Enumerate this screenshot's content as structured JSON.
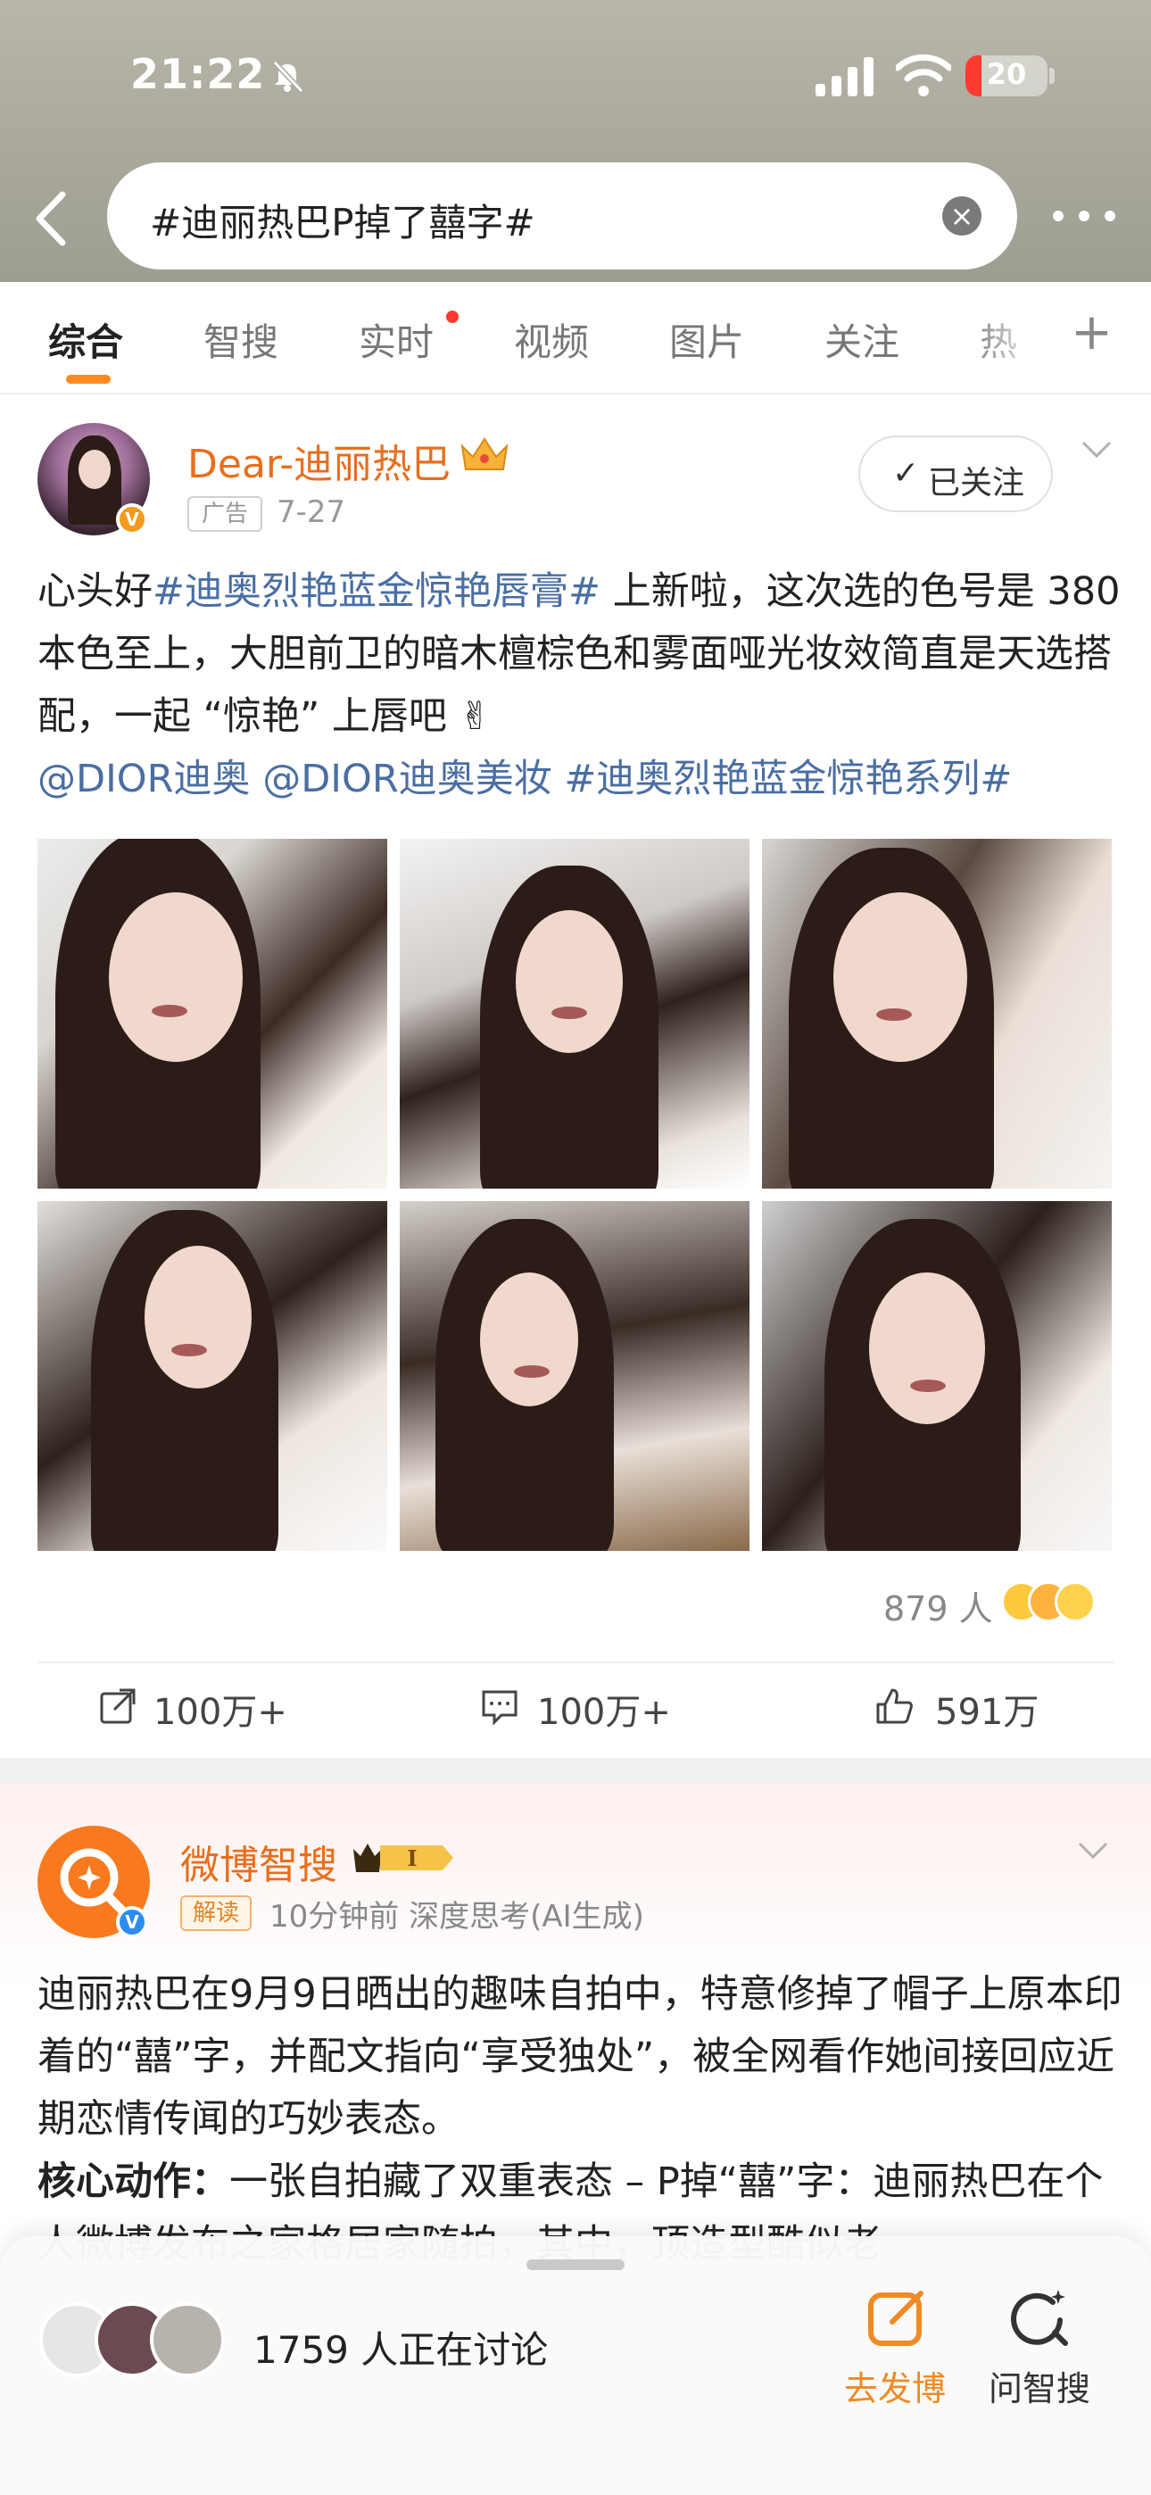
{
  "status_bar": {
    "time": "21:22",
    "battery": "20",
    "battery_level": 0.2
  },
  "search": {
    "query": "#迪丽热巴P掉了囍字#"
  },
  "tabs": [
    {
      "label": "综合",
      "active": true
    },
    {
      "label": "智搜"
    },
    {
      "label": "实时",
      "has_dot": true
    },
    {
      "label": "视频"
    },
    {
      "label": "图片"
    },
    {
      "label": "关注"
    },
    {
      "label": "热"
    }
  ],
  "post1": {
    "author": "Dear-迪丽热巴",
    "ad_label": "广告",
    "date": "7-27",
    "follow_label": "已关注",
    "text_before": "心头好",
    "tag1": "#迪奥烈艳蓝金惊艳唇膏#",
    "text_after": " 上新啦，这次选的色号是 380 本色至上，大胆前卫的暗木檀棕色和雾面哑光妆效简直是天选搭配，一起 “惊艳” 上唇吧 ✌",
    "mention1": "@DIOR迪奥",
    "mention2": "@DIOR迪奥美妆",
    "tag2": "#迪奥烈艳蓝金惊艳系列#",
    "reactions_count": "879 人",
    "reposts": "100万+",
    "comments": "100万+",
    "likes": "591万",
    "image_count": 6
  },
  "post2": {
    "author": "微博智搜",
    "vip_badge": "I",
    "interp_label": "解读",
    "meta": "10分钟前  深度思考(AI生成)",
    "para1": "迪丽热巴在9月9日晒出的趣味自拍中，特意修掉了帽子上原本印着的“囍”字，并配文指向“享受独处”，被全网看作她间接回应近期恋情传闻的巧妙表态。",
    "para2_bold": "核心动作：",
    "para2": "一张自拍藏了双重表态 – P掉“囍”字：迪丽热巴在个人微博发布之家格居家随拍，其中，顶造型酷似老"
  },
  "bottom_bar": {
    "discussing": "1759 人正在讨论",
    "post_label": "去发博",
    "ask_label": "问智搜"
  },
  "colors": {
    "accent_orange": "#ff8a1f",
    "author_orange": "#e86e1c",
    "hashtag_blue": "#4a6ea3"
  }
}
